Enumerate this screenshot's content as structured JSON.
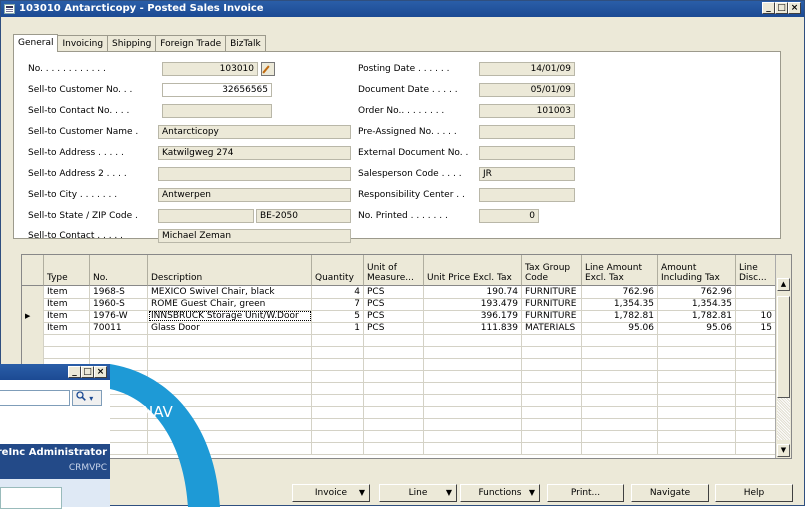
{
  "window": {
    "title": "103010 Antarcticopy - Posted Sales Invoice",
    "min": "_",
    "max": "□",
    "close": "×"
  },
  "tabs": [
    "General",
    "Invoicing",
    "Shipping",
    "Foreign Trade",
    "BizTalk"
  ],
  "general": {
    "left": [
      {
        "label": "No. . . . . . . . . . . .",
        "value": "103010"
      },
      {
        "label": "Sell-to Customer No. . .",
        "value": "32656565"
      },
      {
        "label": "Sell-to Contact No. . . .",
        "value": ""
      },
      {
        "label": "Sell-to Customer Name . ",
        "value": "Antarcticopy"
      },
      {
        "label": "Sell-to Address . . . . .",
        "value": "Katwilgweg 274"
      },
      {
        "label": "Sell-to Address 2 . . . .",
        "value": ""
      },
      {
        "label": "Sell-to City . . . . . . .",
        "value": "Antwerpen"
      },
      {
        "label": "Sell-to State / ZIP Code .",
        "value": "",
        "value2": "BE-2050"
      },
      {
        "label": "Sell-to Contact . . . . .",
        "value": "Michael Zeman"
      }
    ],
    "right": [
      {
        "label": "Posting Date . . . . . .",
        "value": "14/01/09"
      },
      {
        "label": "Document Date . . . . .",
        "value": "05/01/09"
      },
      {
        "label": "Order No.. . . . . . . .",
        "value": "101003"
      },
      {
        "label": "Pre-Assigned No. . . . .",
        "value": ""
      },
      {
        "label": "External Document No. .",
        "value": ""
      },
      {
        "label": "Salesperson Code . . . .",
        "value": "JR"
      },
      {
        "label": "Responsibility Center . .",
        "value": ""
      },
      {
        "label": "No. Printed . . . . . . .",
        "value": "0"
      }
    ]
  },
  "lines": {
    "headers": [
      "Type",
      "No.",
      "Description",
      "Quantity",
      "Unit of Measure...",
      "Unit Price Excl. Tax",
      "Tax Group Code",
      "Line Amount Excl. Tax",
      "Amount Including Tax",
      "Line Disc..."
    ],
    "rows": [
      [
        "Item",
        "1968-S",
        "MEXICO Swivel Chair, black",
        "4",
        "PCS",
        "190.74",
        "FURNITURE",
        "762.96",
        "762.96",
        ""
      ],
      [
        "Item",
        "1960-S",
        "ROME Guest Chair, green",
        "7",
        "PCS",
        "193.479",
        "FURNITURE",
        "1,354.35",
        "1,354.35",
        ""
      ],
      [
        "Item",
        "1976-W",
        "INNSBRUCK Storage Unit/W.Door",
        "5",
        "PCS",
        "396.179",
        "FURNITURE",
        "1,782.81",
        "1,782.81",
        "10"
      ],
      [
        "Item",
        "70011",
        "Glass Door",
        "1",
        "PCS",
        "111.839",
        "MATERIALS",
        "95.06",
        "95.06",
        "15"
      ]
    ]
  },
  "buttons": {
    "invoice": "Invoice",
    "line": "Line",
    "functions": "Functions",
    "print": "Print...",
    "navigate": "Navigate",
    "help": "Help"
  },
  "background_window": {
    "user": "reInc Administrator",
    "machine": "CRMVPC",
    "search_icon": "magnifier-icon"
  },
  "nav_badge": "NAV",
  "colors": {
    "titlebar": "#1c4a93",
    "nav_arc": "#1e9ad6",
    "panel_bg": "#ece9d8"
  }
}
